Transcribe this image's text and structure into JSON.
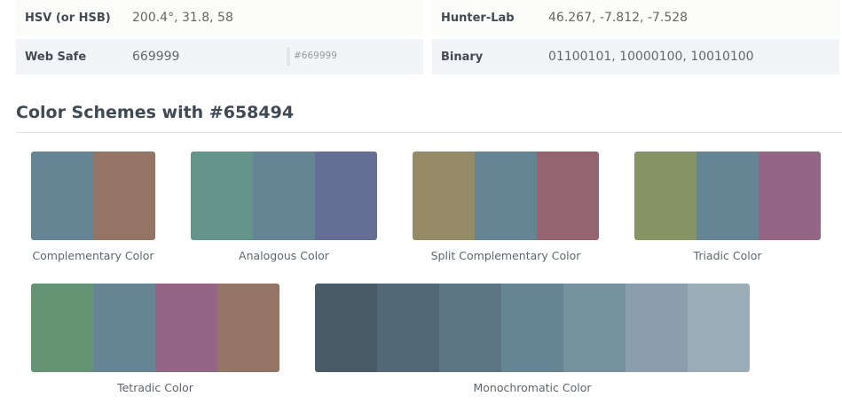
{
  "info": {
    "hsv": {
      "label": "HSV (or HSB)",
      "value": "200.4°, 31.8, 58"
    },
    "hunter": {
      "label": "Hunter-Lab",
      "value": "46.267, -7.812, -7.528"
    },
    "websafe": {
      "label": "Web Safe",
      "value": "669999",
      "hex": "#669999"
    },
    "binary": {
      "label": "Binary",
      "value": "01100101, 10000100, 10010100"
    }
  },
  "heading": "Color Schemes with #658494",
  "schemes": [
    {
      "name": "Complementary Color",
      "colors": [
        "#658494",
        "#947565"
      ]
    },
    {
      "name": "Analogous Color",
      "colors": [
        "#65948a",
        "#658494",
        "#656e94"
      ]
    },
    {
      "name": "Split Complementary Color",
      "colors": [
        "#948a65",
        "#658494",
        "#946570"
      ]
    },
    {
      "name": "Triadic Color",
      "colors": [
        "#849465",
        "#658494",
        "#946584"
      ]
    },
    {
      "name": "Tetradic Color",
      "colors": [
        "#659475",
        "#658494",
        "#946584",
        "#947565"
      ]
    },
    {
      "name": "Monochromatic Color",
      "colors": [
        "#485b67",
        "#526874",
        "#5c7684",
        "#658494",
        "#76929f",
        "#8a9fab",
        "#9aacb6"
      ]
    }
  ]
}
